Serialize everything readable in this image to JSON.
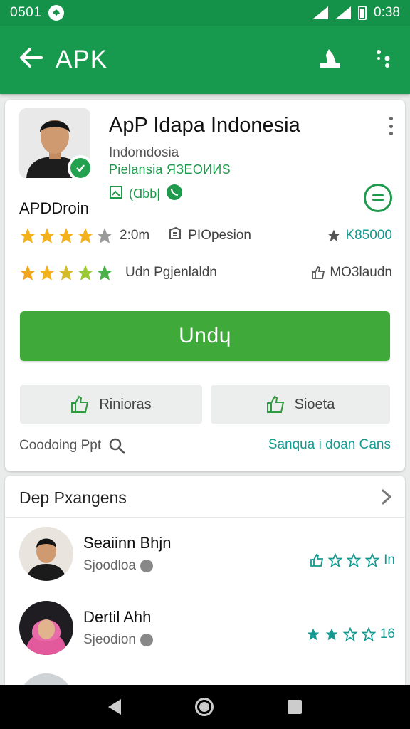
{
  "status_bar": {
    "time": "0501",
    "clock": "0:38"
  },
  "app_bar": {
    "back_icon": "arrow-left-icon",
    "title": "APK",
    "action_icons": [
      "share-icon",
      "more-icon"
    ]
  },
  "app_card": {
    "title": "ApP  Idapa Indonesia",
    "developer": "Indomdosia",
    "developer_sub": "Pielansia  ЯЗЕОИИS",
    "tags_text": "(Ɑbb|",
    "side_name": "APDDroin",
    "rating_row_1": {
      "stars": 4,
      "value": "2:0m",
      "middle": "PIOpesion",
      "right": "K85000"
    },
    "rating_row_2": {
      "stars": 5,
      "text": "Udn Pgjenlaldn",
      "right": "MO3laudn"
    },
    "install_label": "Undɥ",
    "secondary_buttons": [
      "Rinioras",
      "Sioeta"
    ],
    "footer_left": "Coodoing Ppt",
    "footer_right": "Sanqua i doan Cans"
  },
  "section": {
    "title": "Dep Pxangens",
    "people": [
      {
        "name": "Seaiinn Bhjn",
        "subtitle": "Sjoodloa",
        "rating_text": "In",
        "rating_stars": 4
      },
      {
        "name": "Dertil Ahh",
        "subtitle": "Sjeodion",
        "rating_text": "16",
        "rating_stars": 2
      }
    ]
  },
  "colors": {
    "primary": "#189a4e",
    "install": "#3faa3a",
    "teal": "#139a90"
  }
}
